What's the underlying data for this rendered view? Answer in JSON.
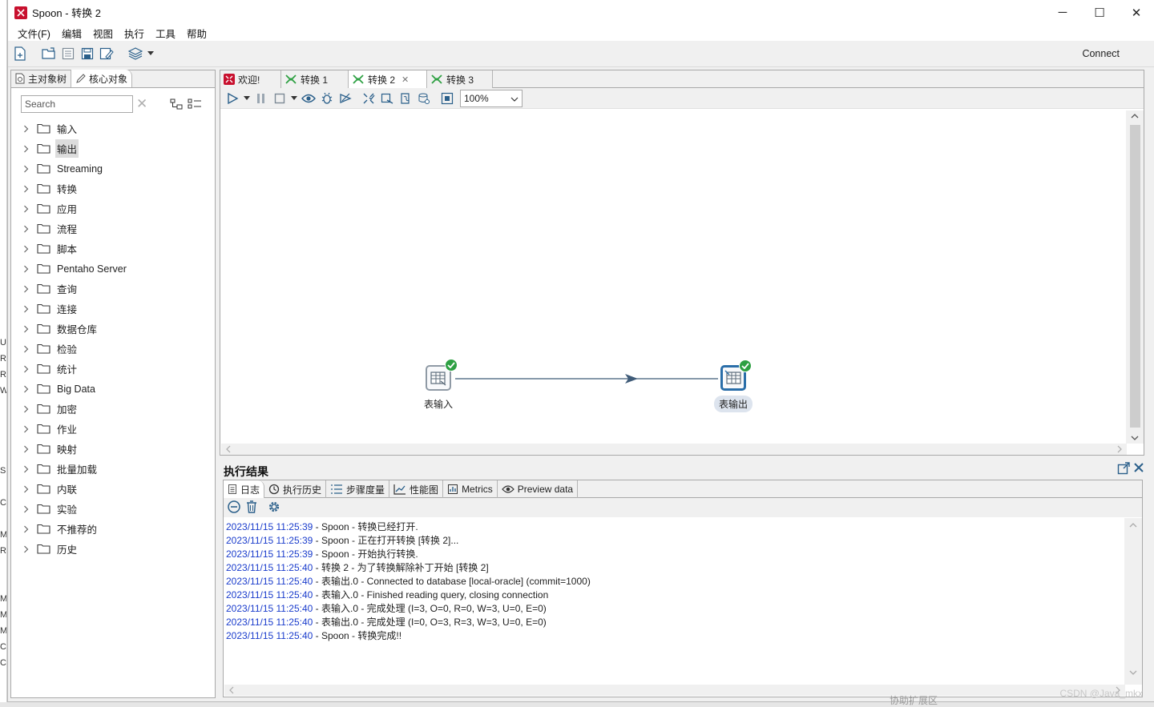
{
  "window": {
    "title": "Spoon - 转换 2",
    "controls": {
      "minimize": "─",
      "maximize": "☐",
      "close": "✕"
    }
  },
  "menu": [
    "文件(F)",
    "编辑",
    "视图",
    "执行",
    "工具",
    "帮助"
  ],
  "toolbar": {
    "connect_label": "Connect"
  },
  "left_panel": {
    "tabs": [
      {
        "label": "主对象树",
        "icon": "tree-icon",
        "active": false
      },
      {
        "label": "核心对象",
        "icon": "pencil-icon",
        "active": true
      }
    ],
    "search": {
      "placeholder": "Search",
      "value": ""
    },
    "tree": [
      {
        "label": "输入",
        "selected": false
      },
      {
        "label": "输出",
        "selected": true
      },
      {
        "label": "Streaming",
        "selected": false
      },
      {
        "label": "转换",
        "selected": false
      },
      {
        "label": "应用",
        "selected": false
      },
      {
        "label": "流程",
        "selected": false
      },
      {
        "label": "脚本",
        "selected": false
      },
      {
        "label": "Pentaho Server",
        "selected": false
      },
      {
        "label": "查询",
        "selected": false
      },
      {
        "label": "连接",
        "selected": false
      },
      {
        "label": "数据仓库",
        "selected": false
      },
      {
        "label": "检验",
        "selected": false
      },
      {
        "label": "统计",
        "selected": false
      },
      {
        "label": "Big Data",
        "selected": false
      },
      {
        "label": "加密",
        "selected": false
      },
      {
        "label": "作业",
        "selected": false
      },
      {
        "label": "映射",
        "selected": false
      },
      {
        "label": "批量加载",
        "selected": false
      },
      {
        "label": "内联",
        "selected": false
      },
      {
        "label": "实验",
        "selected": false
      },
      {
        "label": "不推荐的",
        "selected": false
      },
      {
        "label": "历史",
        "selected": false
      }
    ]
  },
  "doc_tabs": [
    {
      "label": "欢迎!",
      "icon": "spoon-logo-icon",
      "active": false,
      "closable": false
    },
    {
      "label": "转换 1",
      "icon": "transformation-icon",
      "active": false,
      "closable": false
    },
    {
      "label": "转换 2",
      "icon": "transformation-icon",
      "active": true,
      "closable": true
    },
    {
      "label": "转换 3",
      "icon": "transformation-icon",
      "active": false,
      "closable": false
    }
  ],
  "canvas": {
    "zoom": "100%",
    "steps": [
      {
        "label": "表输入",
        "status": "ok",
        "selected": false
      },
      {
        "label": "表输出",
        "status": "ok",
        "selected": true
      }
    ]
  },
  "results": {
    "title": "执行结果",
    "tabs": [
      {
        "label": "日志",
        "icon": "log-icon",
        "active": true
      },
      {
        "label": "执行历史",
        "icon": "history-icon",
        "active": false
      },
      {
        "label": "步骤度量",
        "icon": "list-icon",
        "active": false
      },
      {
        "label": "性能图",
        "icon": "chart-icon",
        "active": false
      },
      {
        "label": "Metrics",
        "icon": "metrics-icon",
        "active": false
      },
      {
        "label": "Preview data",
        "icon": "eye-icon",
        "active": false
      }
    ],
    "log": [
      {
        "ts": "2023/11/15 11:25:39",
        "msg": " - Spoon - 转换已经打开."
      },
      {
        "ts": "2023/11/15 11:25:39",
        "msg": " - Spoon - 正在打开转换 [转换 2]..."
      },
      {
        "ts": "2023/11/15 11:25:39",
        "msg": " - Spoon - 开始执行转换."
      },
      {
        "ts": "2023/11/15 11:25:40",
        "msg": " - 转换 2 - 为了转换解除补丁开始  [转换 2]"
      },
      {
        "ts": "2023/11/15 11:25:40",
        "msg": " - 表输出.0 - Connected to database [local-oracle] (commit=1000)"
      },
      {
        "ts": "2023/11/15 11:25:40",
        "msg": " - 表输入.0 - Finished reading query, closing connection"
      },
      {
        "ts": "2023/11/15 11:25:40",
        "msg": " - 表输入.0 - 完成处理 (I=3, O=0, R=0, W=3, U=0, E=0)"
      },
      {
        "ts": "2023/11/15 11:25:40",
        "msg": " - 表输出.0 - 完成处理 (I=0, O=3, R=3, W=3, U=0, E=0)"
      },
      {
        "ts": "2023/11/15 11:25:40",
        "msg": " - Spoon - 转换完成!!"
      }
    ]
  },
  "watermark": "CSDN @Java_mkx",
  "bottom_hint": "协助扩展区",
  "edge_glyphs": [
    "U",
    "R",
    "R",
    "W",
    "S",
    "C",
    "MI",
    "R",
    "M",
    "M",
    "M",
    "C",
    "C"
  ],
  "colors": {
    "accent": "#2a6ea9",
    "ok": "#2ea043",
    "timestamp": "#1a3ccc",
    "brand": "#c8102e"
  }
}
